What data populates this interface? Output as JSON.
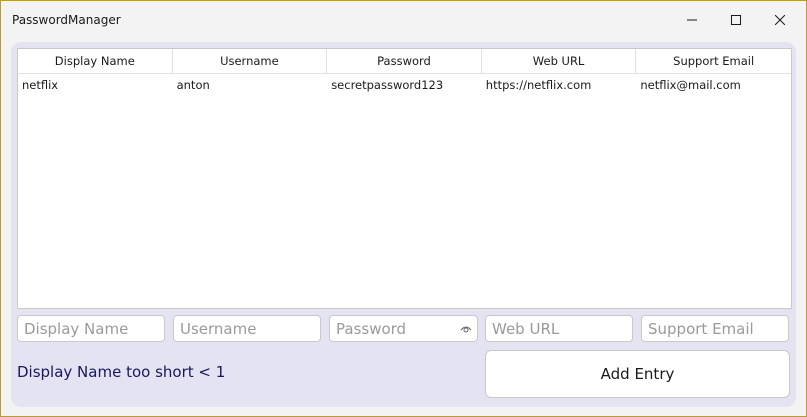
{
  "window": {
    "title": "PasswordManager"
  },
  "table": {
    "columns": [
      "Display Name",
      "Username",
      "Password",
      "Web URL",
      "Support Email"
    ],
    "rows": [
      [
        "netflix",
        "anton",
        "secretpassword123",
        "https://netflix.com",
        "netflix@mail.com"
      ]
    ]
  },
  "form": {
    "display_name": {
      "value": "",
      "placeholder": "Display Name"
    },
    "username": {
      "value": "",
      "placeholder": "Username"
    },
    "password": {
      "value": "",
      "placeholder": "Password"
    },
    "web_url": {
      "value": "",
      "placeholder": "Web URL"
    },
    "support_email": {
      "value": "",
      "placeholder": "Support Email"
    },
    "error_message": "Display Name too short < 1",
    "add_button_label": "Add Entry"
  },
  "icons": {
    "minimize": "minimize-icon",
    "maximize": "maximize-icon",
    "close": "close-icon",
    "password_toggle": "eye-icon"
  },
  "colors": {
    "panel_background": "#e4e3f1",
    "error_text": "#17185c"
  }
}
